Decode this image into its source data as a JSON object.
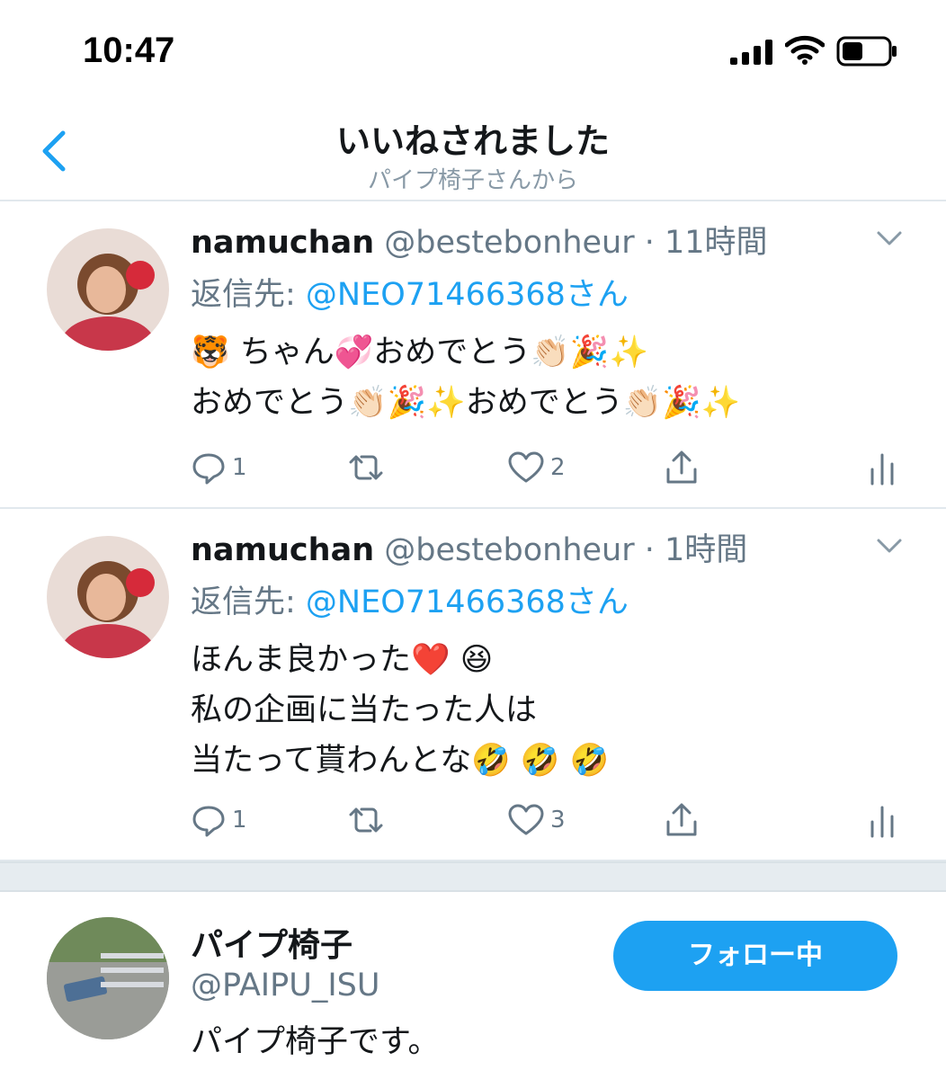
{
  "status_bar": {
    "time": "10:47"
  },
  "header": {
    "title": "いいねされました",
    "subtitle": "パイプ椅子さんから"
  },
  "tweets": [
    {
      "name": "namuchan",
      "handle": "@bestebonheur",
      "time": "· 11時間",
      "reply_label": "返信先: ",
      "reply_to": "@NEO71466368さん",
      "text_lines": [
        "🐯 ちゃん💞おめでとう👏🏻🎉✨",
        "おめでとう👏🏻🎉✨おめでとう👏🏻🎉✨"
      ],
      "replies": "1",
      "likes": "2"
    },
    {
      "name": "namuchan",
      "handle": "@bestebonheur",
      "time": "· 1時間",
      "reply_label": "返信先: ",
      "reply_to": "@NEO71466368さん",
      "text_lines": [
        "ほんま良かった❤️ 😆",
        "私の企画に当たった人は",
        "当たって貰わんとな🤣 🤣 🤣"
      ],
      "replies": "1",
      "likes": "3"
    }
  ],
  "user": {
    "name": "パイプ椅子",
    "handle": "@PAIPU_ISU",
    "bio": "パイプ椅子です。",
    "follow_label": "フォロー中"
  },
  "colors": {
    "accent": "#1da1f2",
    "secondary_text": "#657786",
    "divider": "#e1e8ed"
  }
}
